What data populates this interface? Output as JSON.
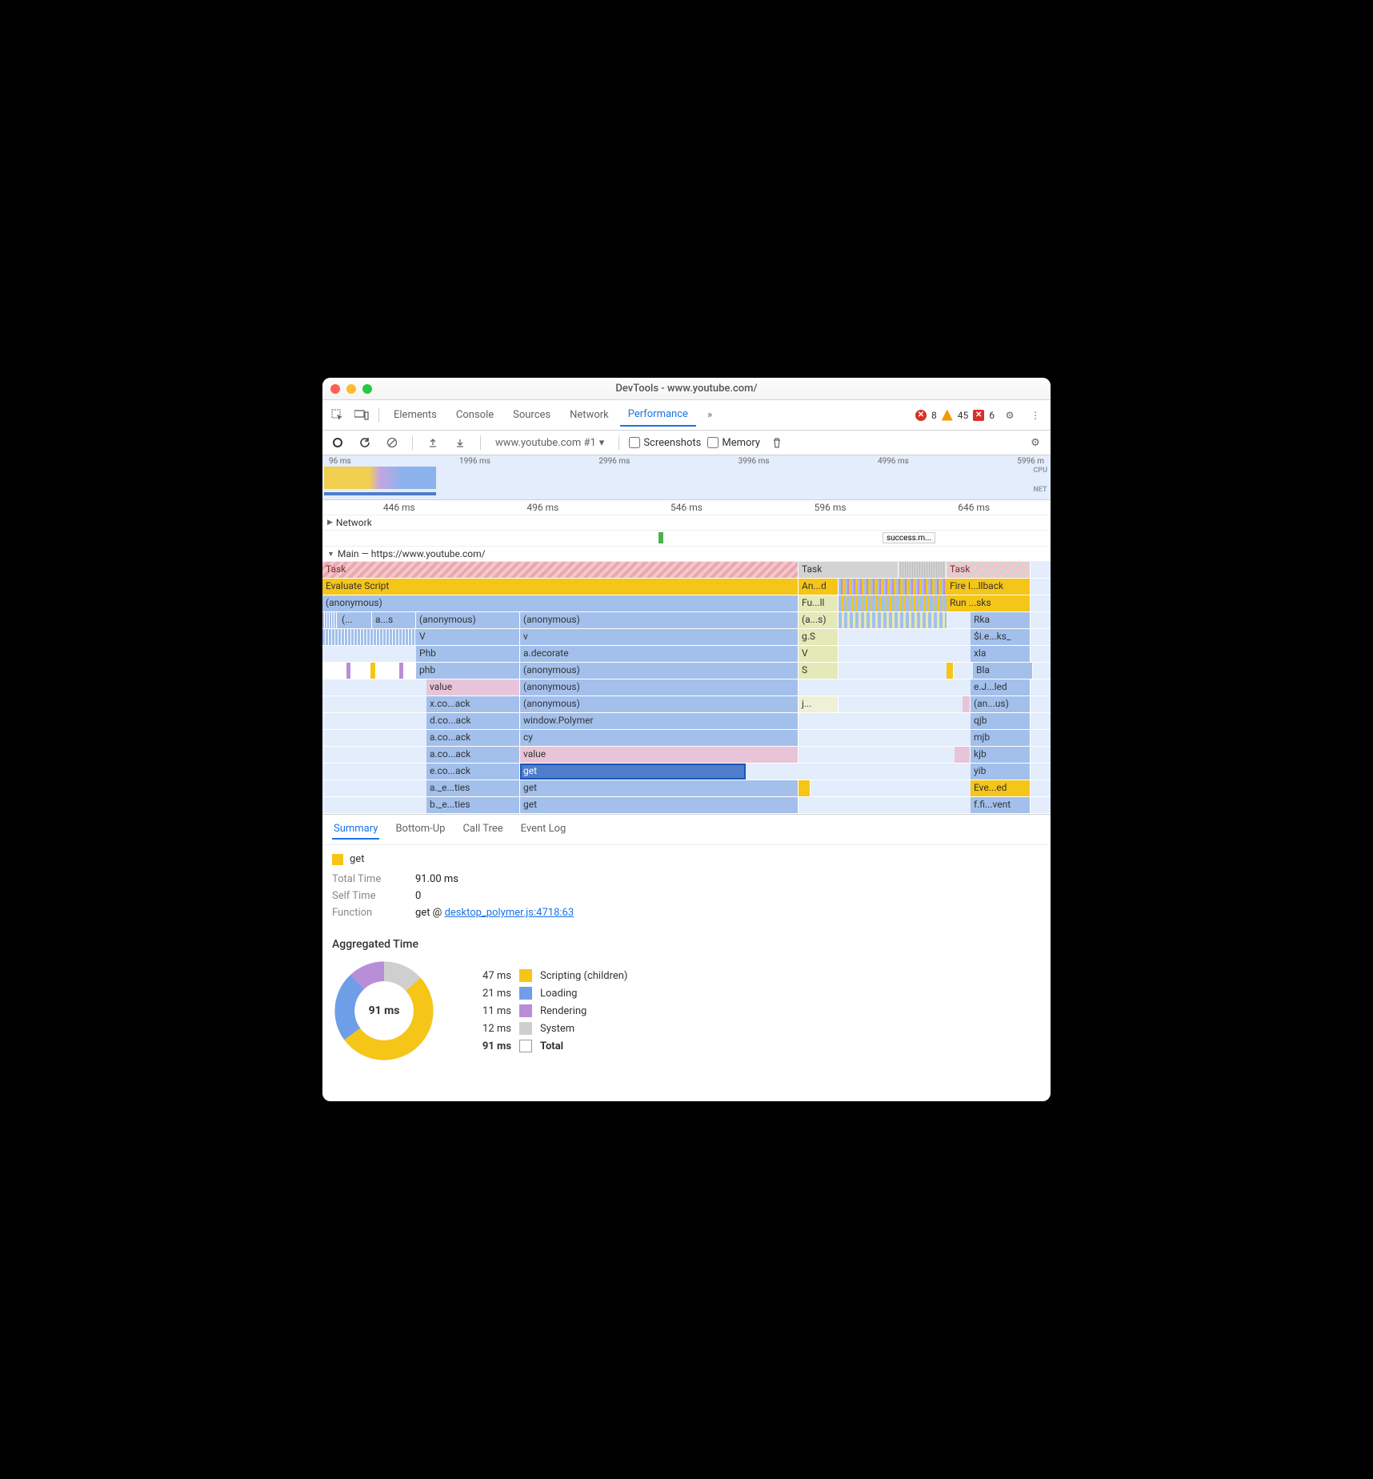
{
  "window": {
    "title": "DevTools - www.youtube.com/"
  },
  "tabs": {
    "elements": "Elements",
    "console": "Console",
    "sources": "Sources",
    "network": "Network",
    "performance": "Performance",
    "more": "»"
  },
  "counts": {
    "errors": "8",
    "warnings": "45",
    "other": "6"
  },
  "toolbar": {
    "target": "www.youtube.com #1",
    "screenshots": "Screenshots",
    "memory": "Memory"
  },
  "overview": {
    "ticks": [
      "96 ms",
      "1996 ms",
      "2996 ms",
      "3996 ms",
      "4996 ms",
      "5996 m"
    ],
    "cpu": "CPU",
    "net": "NET"
  },
  "ruler": {
    "ticks": [
      "446 ms",
      "496 ms",
      "546 ms",
      "596 ms",
      "646 ms"
    ]
  },
  "network_section": "Network",
  "network_item": "success.m...",
  "main_section": "Main — https://www.youtube.com/",
  "flame": {
    "c1": {
      "task": "Task",
      "task2": "Task",
      "task3": "Task"
    },
    "c2": {
      "eval": "Evaluate Script",
      "and": "An...d",
      "fire": "Fire I...llback"
    },
    "c3": {
      "anon": "(anonymous)",
      "full": "Fu...ll",
      "run": "Run ...sks"
    },
    "c4": {
      "left1": "(...",
      "left2": "a...s",
      "anon1": "(anonymous)",
      "anon2": "(anonymous)",
      "as": "(a...s)",
      "rka": "Rka"
    },
    "c5": {
      "V": "V",
      "v": "v",
      "gS": "g.S",
      "ie": "$i.e...ks_"
    },
    "c6": {
      "Phb": "Phb",
      "adec": "a.decorate",
      "V": "V",
      "xla": "xla"
    },
    "c7": {
      "phb": "phb",
      "anon": "(anonymous)",
      "S": "S",
      "bla": "Bla"
    },
    "c8": {
      "value": "value",
      "anon": "(anonymous)",
      "ej": "e.J...led"
    },
    "c9": {
      "xco": "x.co...ack",
      "anon": "(anonymous)",
      "j": "j...",
      "anus": "(an...us)"
    },
    "c10": {
      "dco": "d.co...ack",
      "wp": "window.Polymer",
      "qjb": "qjb"
    },
    "c11": {
      "aco": "a.co...ack",
      "cy": "cy",
      "mjb": "mjb"
    },
    "c12": {
      "aco": "a.co...ack",
      "value": "value",
      "kjb": "kjb"
    },
    "c13": {
      "eco": "e.co...ack",
      "get": "get",
      "yib": "yib"
    },
    "c14": {
      "ae": "a._e...ties",
      "get": "get",
      "eve": "Eve...ed"
    },
    "c15": {
      "be": "b._e...ties",
      "get": "get",
      "ffi": "f.fi...vent"
    }
  },
  "dtabs": {
    "summary": "Summary",
    "bottomup": "Bottom-Up",
    "calltree": "Call Tree",
    "eventlog": "Event Log"
  },
  "summary": {
    "fn": "get",
    "total_label": "Total Time",
    "total": "91.00 ms",
    "self_label": "Self Time",
    "self": "0",
    "func_label": "Function",
    "func_pre": "get @ ",
    "func_link": "desktop_polymer.js:4718:63"
  },
  "agg": {
    "title": "Aggregated Time",
    "center": "91 ms",
    "rows": [
      {
        "ms": "47 ms",
        "color": "#f5c518",
        "label": "Scripting (children)"
      },
      {
        "ms": "21 ms",
        "color": "#6f9ee8",
        "label": "Loading"
      },
      {
        "ms": "11 ms",
        "color": "#b98ed8",
        "label": "Rendering"
      },
      {
        "ms": "12 ms",
        "color": "#cfcfcf",
        "label": "System"
      }
    ],
    "total": {
      "ms": "91 ms",
      "label": "Total"
    }
  },
  "chart_data": {
    "type": "pie",
    "title": "Aggregated Time",
    "series": [
      {
        "name": "Scripting (children)",
        "value": 47,
        "unit": "ms",
        "color": "#f5c518"
      },
      {
        "name": "Loading",
        "value": 21,
        "unit": "ms",
        "color": "#6f9ee8"
      },
      {
        "name": "Rendering",
        "value": 11,
        "unit": "ms",
        "color": "#b98ed8"
      },
      {
        "name": "System",
        "value": 12,
        "unit": "ms",
        "color": "#cfcfcf"
      }
    ],
    "total": 91
  }
}
